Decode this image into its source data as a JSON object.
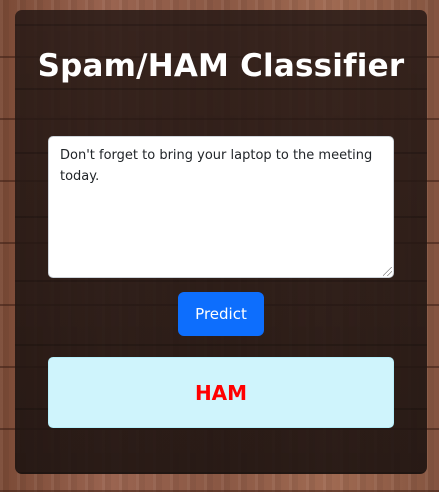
{
  "header": {
    "title": "Spam/HAM Classifier"
  },
  "form": {
    "message_value": "Don't forget to bring your laptop to the meeting today.",
    "predict_label": "Predict"
  },
  "result": {
    "label": "HAM",
    "color": "#ff0000",
    "box_color": "#cff4fc"
  },
  "theme": {
    "button_color": "#0d6efd",
    "card_color": "#2a1c18"
  }
}
